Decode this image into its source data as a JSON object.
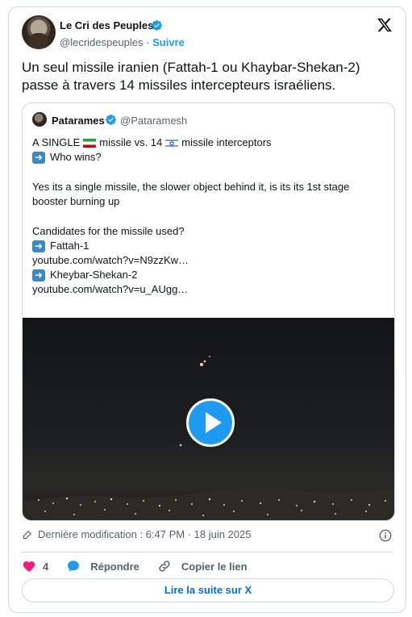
{
  "author": {
    "name": "Le Cri des Peuples",
    "handle": "@lecridespeuples",
    "separator": "·",
    "follow_label": "Suivre"
  },
  "tweet_text": "Un seul missile iranien (Fattah-1 ou Khaybar-Shekan-2) passe à travers 14 missiles intercepteurs israéliens.",
  "quoted": {
    "name": "Patarames",
    "handle": "@Pataramesh",
    "line1_a": "A SINGLE",
    "line1_b": "missile vs. 14",
    "line1_c": "missile interceptors",
    "line2": "Who wins?",
    "para2": "Yes its a single missile, the slower object behind it, is its its 1st stage booster burning up",
    "para3_title": "Candidates for the missile used?",
    "candidate1": "Fattah-1",
    "link1": "youtube.com/watch?v=N9zzKw…",
    "candidate2": "Kheybar-Shekan-2",
    "link2": "youtube.com/watch?v=u_AUgg…"
  },
  "meta": {
    "modified": "Dernière modification : 6:47 PM · 18 juin 2025"
  },
  "actions": {
    "like_count": "4",
    "reply_label": "Répondre",
    "copy_label": "Copier le lien"
  },
  "read_more_label": "Lire la suite sur X",
  "colors": {
    "accent": "#1d9bf0",
    "like": "#f91880",
    "text": "#0f1419",
    "secondary": "#536471",
    "border": "#cfd9de"
  }
}
